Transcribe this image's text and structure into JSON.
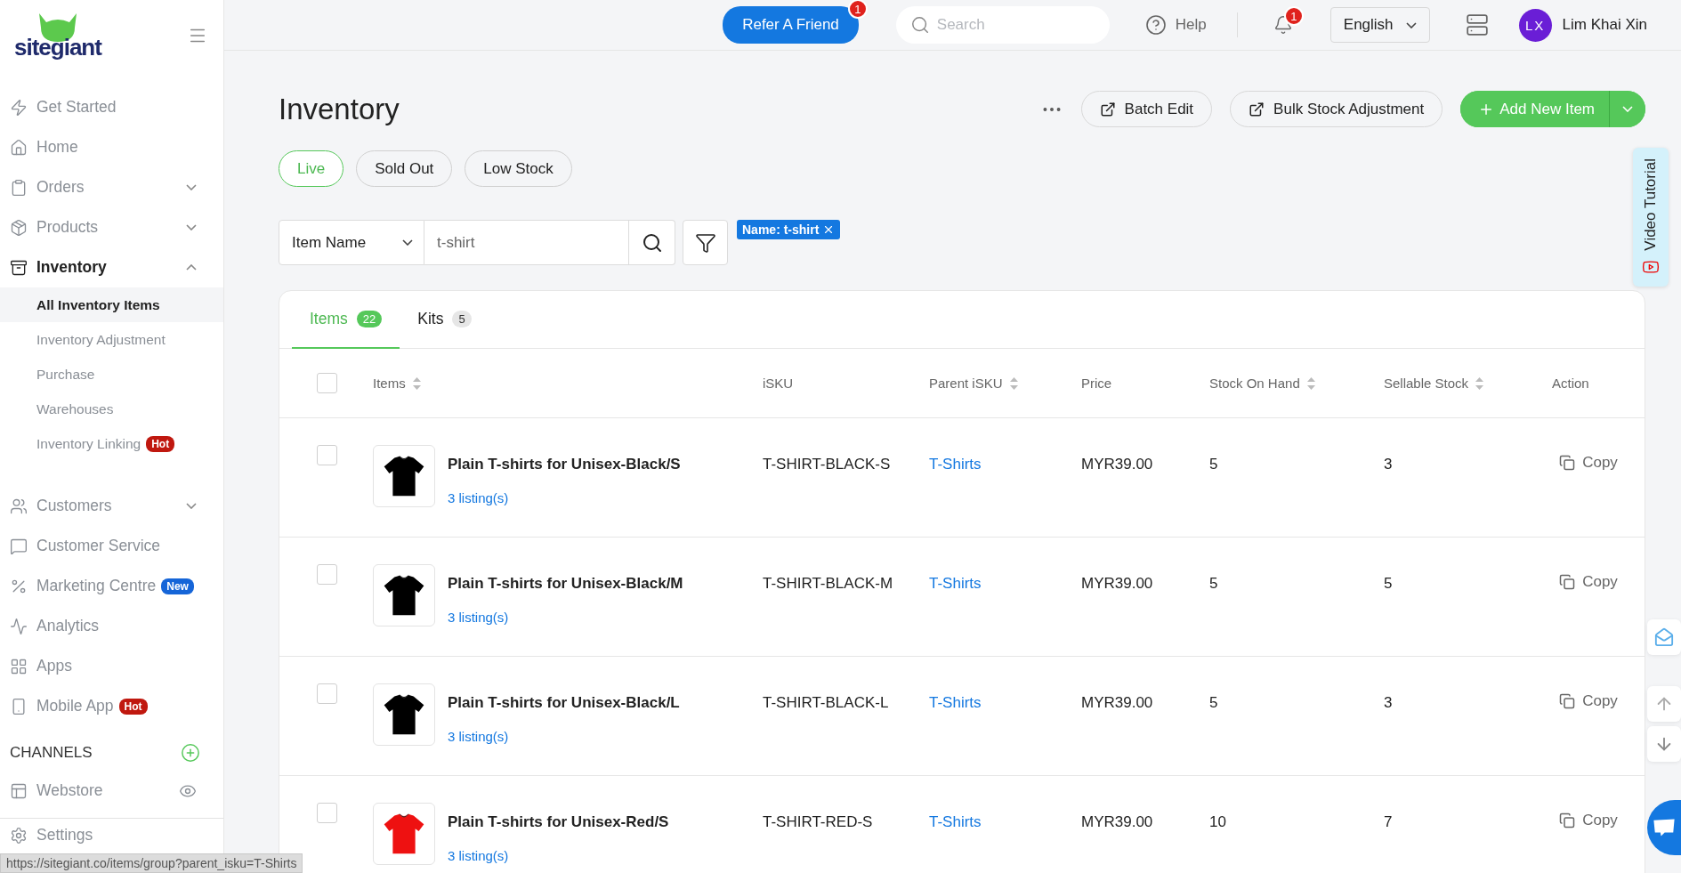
{
  "logo": {
    "text": "sitegiant"
  },
  "sidebar": {
    "items": [
      {
        "label": "Get Started",
        "kind": "link"
      },
      {
        "label": "Home",
        "kind": "link"
      },
      {
        "label": "Orders",
        "kind": "group",
        "expanded": false
      },
      {
        "label": "Products",
        "kind": "group",
        "expanded": false
      },
      {
        "label": "Inventory",
        "kind": "group",
        "expanded": true,
        "children": [
          {
            "label": "All Inventory Items",
            "selected": true
          },
          {
            "label": "Inventory Adjustment",
            "selected": false
          },
          {
            "label": "Purchase",
            "selected": false
          },
          {
            "label": "Warehouses",
            "selected": false
          },
          {
            "label": "Inventory Linking",
            "selected": false,
            "badge": {
              "text": "Hot",
              "color": "#c0180f"
            }
          }
        ]
      },
      {
        "label": "Customers",
        "kind": "group",
        "expanded": false
      },
      {
        "label": "Customer Service",
        "kind": "link"
      },
      {
        "label": "Marketing Centre",
        "kind": "link",
        "badge": {
          "text": "New",
          "color": "#1565d8"
        }
      },
      {
        "label": "Analytics",
        "kind": "link"
      },
      {
        "label": "Apps",
        "kind": "link"
      },
      {
        "label": "Mobile App",
        "kind": "link",
        "badge": {
          "text": "Hot",
          "color": "#c0180f"
        }
      }
    ],
    "channels_heading": "CHANNELS",
    "channels": [
      {
        "label": "Webstore"
      }
    ],
    "settings": "Settings"
  },
  "topbar": {
    "refer_button": "Refer A Friend",
    "refer_badge": "1",
    "search": {
      "placeholder": "Search"
    },
    "help": "Help",
    "notification_badge": "1",
    "language": "English",
    "avatar_initials": "LX",
    "user_name": "Lim Khai Xin"
  },
  "page": {
    "title": "Inventory",
    "actions": [
      "Batch Edit",
      "Bulk Stock Adjustment"
    ],
    "add_button": "Add New Item"
  },
  "status_filters": [
    {
      "label": "Live",
      "selected": true
    },
    {
      "label": "Sold Out",
      "selected": false
    },
    {
      "label": "Low Stock",
      "selected": false
    }
  ],
  "search_bar": {
    "field": "Item Name",
    "value": "t-shirt",
    "chip": "Name: t-shirt"
  },
  "tabs": [
    {
      "label": "Items",
      "count": "22",
      "selected": true
    },
    {
      "label": "Kits",
      "count": "5",
      "selected": false
    }
  ],
  "table": {
    "select_all_checked": false,
    "columns": [
      {
        "label": "Items",
        "sortable": true
      },
      {
        "label": "iSKU",
        "sortable": false
      },
      {
        "label": "Parent iSKU",
        "sortable": true
      },
      {
        "label": "Price",
        "sortable": false
      },
      {
        "label": "Stock On Hand",
        "sortable": true
      },
      {
        "label": "Sellable Stock",
        "sortable": true
      },
      {
        "label": "Action",
        "sortable": false
      }
    ],
    "rows": [
      {
        "name": "Plain T-shirts for Unisex-Black/S",
        "listings": "3 listing(s)",
        "isku": "T-SHIRT-BLACK-S",
        "parent_isku": "T-Shirts",
        "price": "MYR39.00",
        "stock_on_hand": "5",
        "sellable_stock": "3",
        "action": "Copy",
        "checked": false
      },
      {
        "name": "Plain T-shirts for Unisex-Black/M",
        "listings": "3 listing(s)",
        "isku": "T-SHIRT-BLACK-M",
        "parent_isku": "T-Shirts",
        "price": "MYR39.00",
        "stock_on_hand": "5",
        "sellable_stock": "5",
        "action": "Copy",
        "checked": false
      },
      {
        "name": "Plain T-shirts for Unisex-Black/L",
        "listings": "3 listing(s)",
        "isku": "T-SHIRT-BLACK-L",
        "parent_isku": "T-Shirts",
        "price": "MYR39.00",
        "stock_on_hand": "5",
        "sellable_stock": "3",
        "action": "Copy",
        "checked": false
      },
      {
        "name": "Plain T-shirts for Unisex-Red/S",
        "listings": "3 listing(s)",
        "isku": "T-SHIRT-RED-S",
        "parent_isku": "T-Shirts",
        "price": "MYR39.00",
        "stock_on_hand": "10",
        "sellable_stock": "7",
        "action": "Copy",
        "checked": false
      }
    ]
  },
  "video_tutorial": "Video Tutorial",
  "status_url": "https://sitegiant.co/items/group?parent_isku=T-Shirts"
}
